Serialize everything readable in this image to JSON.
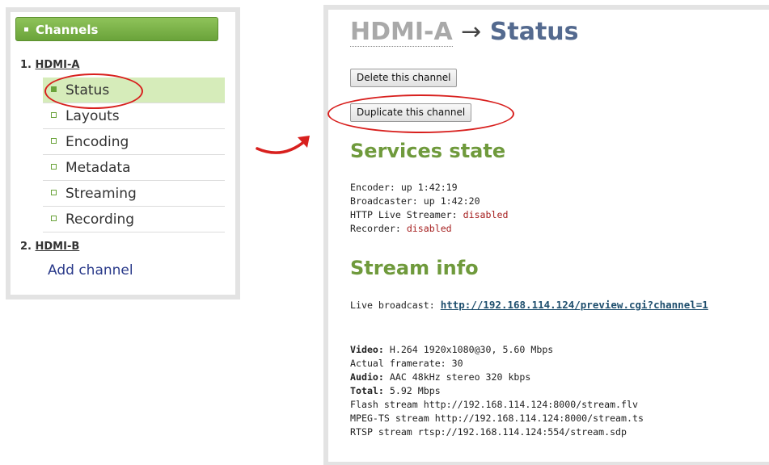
{
  "sidebar": {
    "header": "Channels",
    "channels": [
      {
        "num": "1.",
        "name": "HDMI-A"
      },
      {
        "num": "2.",
        "name": "HDMI-B"
      }
    ],
    "items": [
      "Status",
      "Layouts",
      "Encoding",
      "Metadata",
      "Streaming",
      "Recording"
    ],
    "active_item": "Status",
    "add_channel": "Add channel"
  },
  "page": {
    "channel": "HDMI-A",
    "arrow": "→",
    "section": "Status"
  },
  "buttons": {
    "delete": "Delete this channel",
    "duplicate": "Duplicate this channel"
  },
  "services": {
    "heading": "Services state",
    "lines": [
      {
        "label": "Encoder: ",
        "value": "up 1:42:19"
      },
      {
        "label": "Broadcaster: ",
        "value": "up 1:42:20"
      },
      {
        "label": "HTTP Live Streamer: ",
        "value": "disabled"
      },
      {
        "label": "Recorder: ",
        "value": "disabled"
      }
    ]
  },
  "stream": {
    "heading": "Stream info",
    "live_label": "Live broadcast: ",
    "live_url": "http://192.168.114.124/preview.cgi?channel=1",
    "video_label": "Video:",
    "video_value": " H.264 1920x1080@30, 5.60 Mbps",
    "framerate": "Actual framerate: 30",
    "audio_label": "Audio:",
    "audio_value": " AAC 48kHz stereo 320 kbps",
    "total_label": "Total:",
    "total_value": " 5.92 Mbps",
    "flash": "Flash stream http://192.168.114.124:8000/stream.flv",
    "mpegts": "MPEG-TS stream http://192.168.114.124:8000/stream.ts",
    "rtsp": "RTSP stream rtsp://192.168.114.124:554/stream.sdp"
  },
  "colors": {
    "accent_green": "#6aa33a",
    "highlight_red": "#d8201e",
    "disabled_red": "#a62020"
  }
}
